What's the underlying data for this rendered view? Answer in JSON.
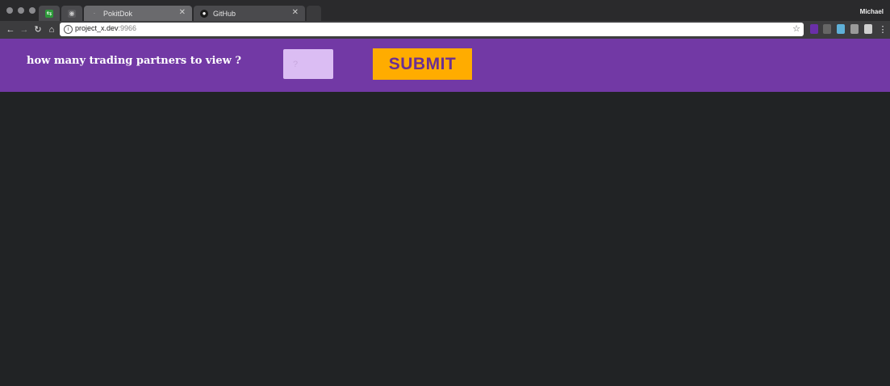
{
  "browser": {
    "tabs": [
      {
        "title": "",
        "icon": "green-extension-icon"
      },
      {
        "title": "",
        "icon": "pinned-app-icon"
      },
      {
        "title": "PokitDok",
        "icon": "pokitdok-icon",
        "active": true
      },
      {
        "title": "GitHub",
        "icon": "github-icon"
      }
    ],
    "profile_name": "Michael",
    "url_host": "project_x.dev",
    "url_port": ":9966"
  },
  "header": {
    "prompt": "how many trading partners to view ?",
    "input_placeholder": "?",
    "submit_label": "SUBMIT"
  },
  "colors": {
    "header_bg": "#7239a5",
    "submit_bg": "#ffac00",
    "submit_text": "#6b2f93",
    "input_bg": "#dbbdf3",
    "page_bg": "#212325"
  }
}
